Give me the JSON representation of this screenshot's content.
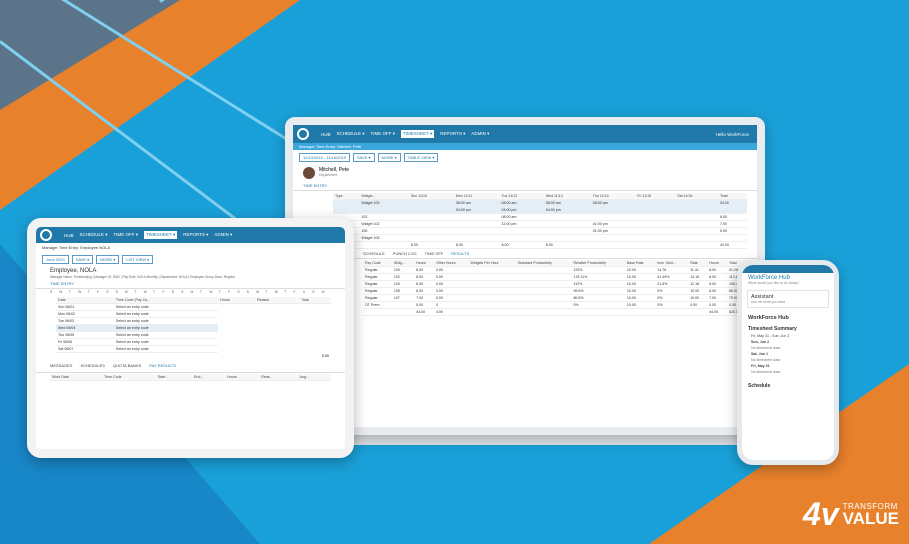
{
  "laptop": {
    "nav": [
      "HUB",
      "SCHEDULE ▾",
      "TIME OFF ▾",
      "TIMESHEET ▾",
      "REPORTS ▾",
      "ADMIN ▾"
    ],
    "nav_user": "Hello WorkForce",
    "subtitle": "Manager Time Entry: Mitchell, Pete",
    "date_range": "11/10/2019 - 11/16/2019",
    "buttons": [
      "SAVE ▾",
      "MORE ▾",
      "TABLE VIEW ▾"
    ],
    "employee": "Mitchell, Pete",
    "department": "Department",
    "tab": "TIME ENTRY",
    "grid_head": [
      "Type",
      "Widget...",
      "Sun 11/10",
      "Mon 11/11",
      "Tue 11/12",
      "Wed 11/13",
      "Thu 11/14",
      "Fri 11/15",
      "Sat 11/16",
      "Total"
    ],
    "grid_rows": [
      [
        "",
        "Widget 100",
        "",
        "08:00 am",
        "08:00 am",
        "08:00 am",
        "08:00 am",
        "",
        "",
        "24.00"
      ],
      [
        "",
        "",
        "",
        "04:00 pm",
        "04:00 pm",
        "04:00 pm",
        "",
        "",
        "",
        ""
      ],
      [
        "",
        "102",
        "",
        "",
        "08:00 am",
        "",
        "",
        "",
        "",
        "8.00"
      ],
      [
        "",
        "Widget 102",
        "",
        "",
        "12:00 pm",
        "",
        "01:00 pm",
        "",
        "",
        "7.00"
      ],
      [
        "",
        "105",
        "",
        "",
        "",
        "",
        "01:00 pm",
        "",
        "",
        "5.00"
      ],
      [
        "",
        "Widget 105",
        "",
        "",
        "",
        "",
        "",
        "",
        "",
        ""
      ]
    ],
    "totals_row": [
      "",
      "",
      "8.00",
      "8.00",
      "8.00",
      "8.00",
      "",
      "",
      "",
      "44.00"
    ],
    "result_tabs": [
      "SCHEDULE",
      "PUNCH LOG",
      "TIME OFF",
      "RESULTS"
    ],
    "result_head": [
      "Pay Code",
      "Widg...",
      "Hours",
      "Other Hours",
      "Widgets Per Hour",
      "Standard Productivity",
      "Relative Productivity",
      "Base Rate",
      "Ince. Mult...",
      "Rate",
      "Hours",
      "Total"
    ],
    "result_rows": [
      [
        "Regular",
        "100",
        "8.00",
        "0.00",
        "",
        "",
        "133%",
        "10.00",
        "14.76",
        "11.41",
        "8.00",
        "91.28"
      ],
      [
        "Regular",
        "102",
        "8.00",
        "0.00",
        "",
        "",
        "178.11%",
        "10.00",
        "41.49%",
        "14.15",
        "8.00",
        "113.17"
      ],
      [
        "Regular",
        "100",
        "8.00",
        "0.00",
        "",
        "",
        "112%",
        "10.00",
        "21.8%",
        "12.18",
        "8.00",
        "105.44"
      ],
      [
        "Regular",
        "105",
        "8.00",
        "0.00",
        "",
        "",
        "99.5%",
        "10.00",
        "0%",
        "10.00",
        "8.00",
        "80.00"
      ],
      [
        "Regular",
        "107",
        "7.00",
        "0.00",
        "",
        "",
        "80.8%",
        "10.00",
        "0%",
        "10.00",
        "7.00",
        "70.00"
      ],
      [
        "OT Prem",
        "",
        "0.00",
        "0",
        "",
        "",
        "0%",
        "10.00",
        "0%",
        "0.00",
        "0.00",
        "0.00"
      ]
    ],
    "result_total": [
      "",
      "",
      "44.00",
      "4.00",
      "",
      "",
      "",
      "",
      "",
      "",
      "44.00",
      "520.00"
    ]
  },
  "tablet": {
    "nav": [
      "HUB",
      "SCHEDULE ▾",
      "TIME OFF ▾",
      "TIMESHEET ▾",
      "REPORTS ▾",
      "ADMIN ▾"
    ],
    "subtitle": "Manager Time Entry: Employee NOLA",
    "date": "June 2024",
    "buttons": [
      "SAVE ▾",
      "MORE ▾",
      "LIST VIEW ▾"
    ],
    "employee": "Employee, NOLA",
    "info": "Manager Name: Timekeeping | Manager ID: 5000 | Pay Rule: NOLA Monthly | Department: NOLA | Employee Group Desc: Regular",
    "tab": "TIME ENTRY",
    "week_letters": [
      "S",
      "M",
      "T",
      "W",
      "T",
      "F",
      "S",
      "S",
      "M",
      "T",
      "W",
      "T",
      "F",
      "S",
      "S",
      "M",
      "T",
      "W",
      "T",
      "F",
      "S",
      "S",
      "M",
      "T",
      "W",
      "T",
      "F",
      "S",
      "S",
      "M"
    ],
    "head": [
      "Date",
      "Time Code (Pay Co...",
      "Hours",
      "Reason",
      "Total"
    ],
    "rows": [
      [
        "Sun 06/01",
        "Select an entry code"
      ],
      [
        "Mon 06/02",
        "Select an entry code"
      ],
      [
        "Tue 06/03",
        "Select an entry code"
      ],
      [
        "Wed 06/04",
        "Select an entry code"
      ],
      [
        "Thu 06/05",
        "Select an entry code"
      ],
      [
        "Fri 06/06",
        "Select an entry code"
      ],
      [
        "Sat 06/07",
        "Select an entry code"
      ]
    ],
    "total": "0.00",
    "bottom_tabs": [
      "MESSAGES",
      "SCHEDULES",
      "QUOTA BANKS",
      "PAY RESULTS"
    ],
    "bottom_head": [
      "Work Date",
      "Time Code",
      "Start...",
      "End...",
      "Hours",
      "Reas...",
      "Aog..."
    ]
  },
  "phone": {
    "title": "WorkForce Hub",
    "sub": "What would you like to do today?",
    "assistant": "Assistant",
    "assistant_sub": "Ask me what you need",
    "hub": "WorkForce Hub",
    "summary": "Timesheet Summary",
    "range": "Fri, May 31 - Sun, Jun 2",
    "days": [
      {
        "day": "Sun, Jun 2",
        "note": "No timesheet data"
      },
      {
        "day": "Sat, Jun 1",
        "note": "No timesheet data"
      },
      {
        "day": "Fri, May 31",
        "note": "No timesheet data"
      }
    ],
    "schedule": "Schedule"
  },
  "brand": {
    "line1": "TRANSFORM",
    "line2": "VALUE",
    "mark": "4v"
  }
}
